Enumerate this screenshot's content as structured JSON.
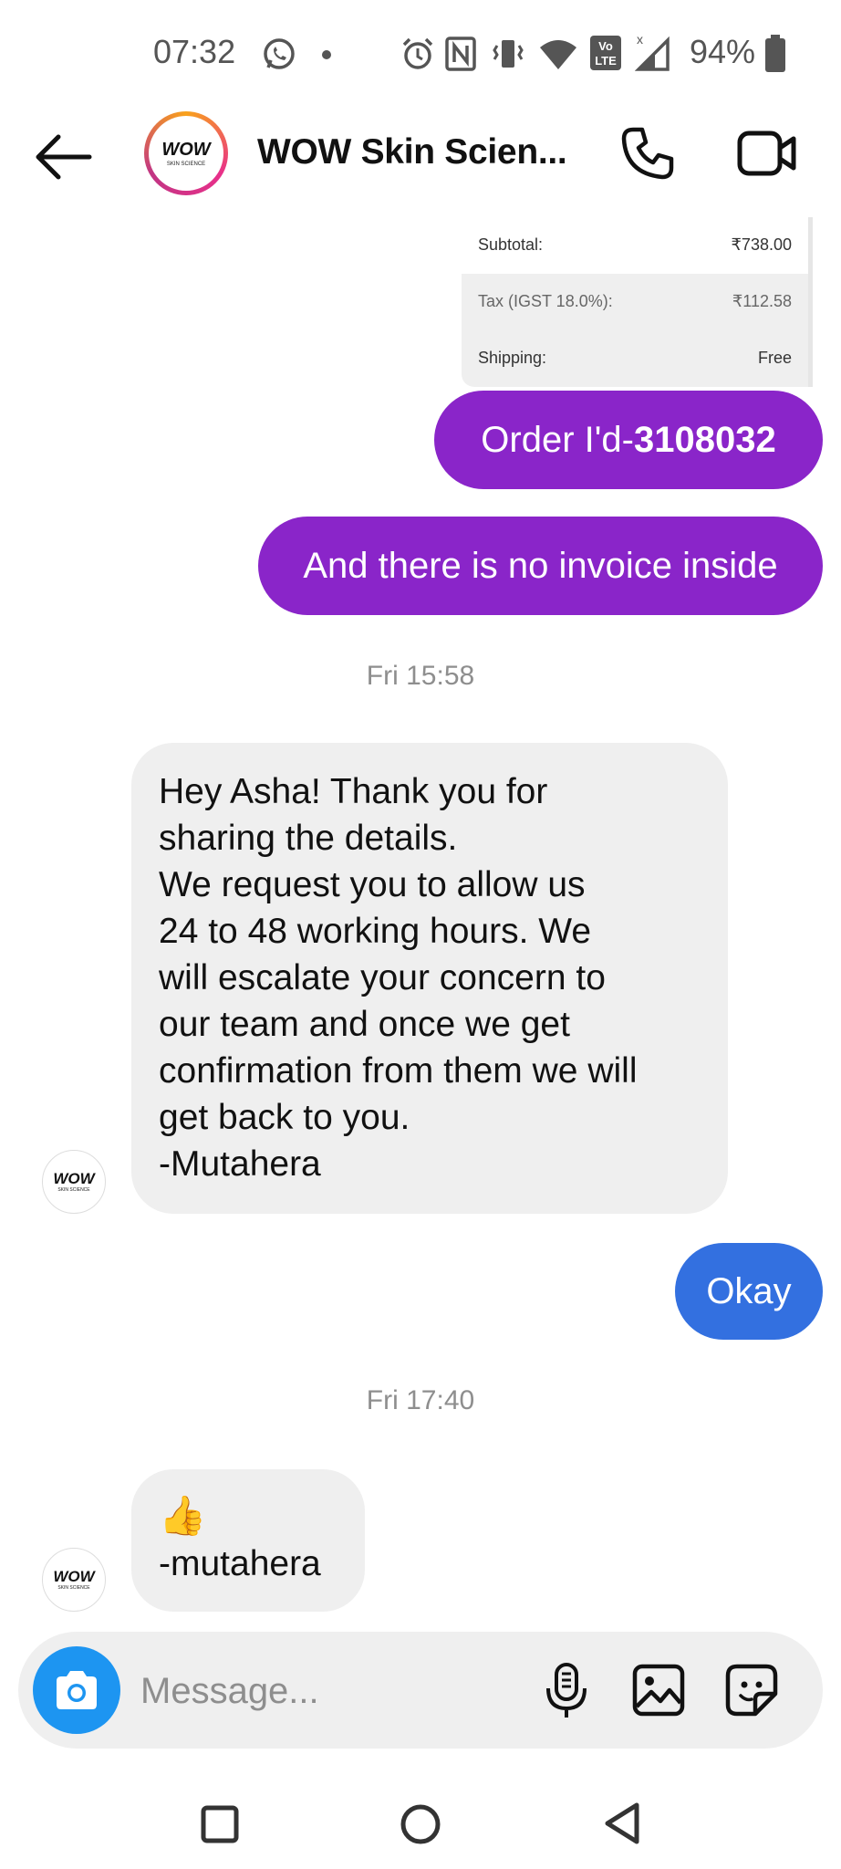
{
  "status_bar": {
    "time": "07:32",
    "battery_percent": "94%",
    "icons": [
      "whatsapp-icon",
      "dot-icon",
      "alarm-icon",
      "nfc-icon",
      "vibrate-icon",
      "wifi-icon",
      "volte-icon",
      "signal-icon",
      "battery-icon"
    ]
  },
  "header": {
    "title": "WOW Skin Scien...",
    "logo_text": "WOW",
    "logo_subtext": "SKIN SCIENCE"
  },
  "invoice": {
    "rows": [
      {
        "label": "Subtotal:",
        "value": "₹738.00"
      },
      {
        "label": "Tax (IGST 18.0%):",
        "value": "₹112.58"
      },
      {
        "label": "Shipping:",
        "value": "Free"
      }
    ]
  },
  "messages": {
    "order_prefix": "Order I'd-",
    "order_id": "3108032",
    "no_invoice": "And there is no invoice inside",
    "time1": "Fri 15:58",
    "reply_lines": [
      "Hey Asha! Thank you for",
      "sharing the details.",
      "We request you to allow us",
      "24 to 48 working hours. We",
      "will escalate your concern to",
      "our team and once we get",
      "confirmation from them we will",
      "get back to you.",
      "-Mutahera"
    ],
    "okay": "Okay",
    "time2": "Fri 17:40",
    "thumbs_emoji": "👍",
    "thumbs_sign": "-mutahera"
  },
  "composer": {
    "placeholder": "Message..."
  },
  "colors": {
    "purple_bubble": "#8a25c9",
    "blue_bubble": "#3370e0",
    "incoming_bubble": "#efefef",
    "camera_button": "#1d95f1"
  }
}
